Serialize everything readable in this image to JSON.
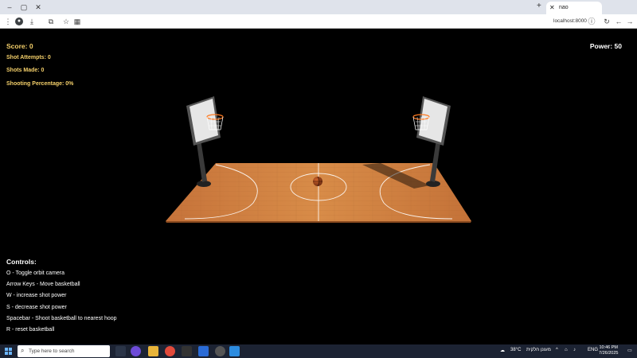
{
  "browser": {
    "tab_title": "nao",
    "url": "localhost:8000"
  },
  "hud": {
    "score": "Score: 0",
    "power": "Power: 50",
    "shot_attempts": "Shot Attempts: 0",
    "shots_made": "Shots Made: 0",
    "shooting_percentage": "Shooting Percentage: 0%"
  },
  "controls": {
    "title": "Controls:",
    "items": [
      "O - Toggle orbit camera",
      "Arrow Keys - Move basketball",
      "W - increase shot power",
      "S - decrease shot power",
      "Spacebar - Shoot basketball to nearest hoop",
      "R - reset basketball"
    ]
  },
  "taskbar": {
    "search_placeholder": "Type here to search",
    "weather": "38°C",
    "weather_note": "מעונן חלקית",
    "language": "ENG",
    "time": "10:46 PM",
    "date": "7/26/2025"
  },
  "colors": {
    "hud_text": "#f5d06a",
    "court_wood": "#c9783a",
    "background": "#000000",
    "taskbar": "#1c2333"
  },
  "icons": {
    "ball": "basketball-icon",
    "search": "search-icon",
    "start": "windows-start-icon"
  }
}
